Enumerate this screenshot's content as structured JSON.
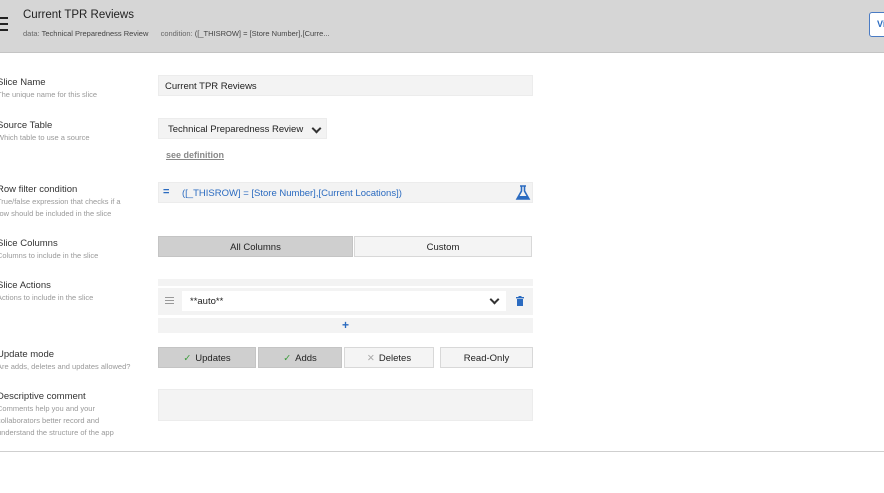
{
  "header": {
    "title": "Current TPR Reviews",
    "data_key": "data:",
    "data_value": "Technical Preparedness Review",
    "condition_key": "condition:",
    "condition_value": "([_THISROW] = [Store Number],[Curre...",
    "view_button": "Vi"
  },
  "form": {
    "slice_name": {
      "label": "Slice Name",
      "desc": "The unique name for this slice",
      "value": "Current TPR Reviews"
    },
    "source_table": {
      "label": "Source Table",
      "desc": "Which table to use a source",
      "value": "Technical Preparedness Review",
      "link": "see definition"
    },
    "row_filter": {
      "label": "Row filter condition",
      "desc_lines": [
        "True/false expression that checks if a",
        "row should be included in the slice"
      ],
      "expr_icon": "=",
      "value": "([_THISROW] = [Store Number],[Current Locations])"
    },
    "slice_columns": {
      "label": "Slice Columns",
      "desc": "Columns to include in the slice",
      "options": [
        "All Columns",
        "Custom"
      ],
      "selected": "All Columns"
    },
    "slice_actions": {
      "label": "Slice Actions",
      "desc": "Actions to include in the slice",
      "value": "**auto**",
      "add_label": "+"
    },
    "update_mode": {
      "label": "Update mode",
      "desc": "Are adds, deletes and updates allowed?",
      "options": [
        {
          "label": "Updates",
          "mark": "✓"
        },
        {
          "label": "Adds",
          "mark": "✓"
        },
        {
          "label": "Deletes",
          "mark": "✕"
        },
        {
          "label": "Read-Only",
          "mark": ""
        }
      ]
    },
    "comment": {
      "label": "Descriptive comment",
      "desc_lines": [
        "Comments help you and your",
        "collaborators better record and",
        "understand the structure of the app"
      ],
      "value": ""
    }
  },
  "colors": {
    "accent": "#2b6bc0",
    "header_bg": "#d6d6d6",
    "check": "#3a9c3a"
  },
  "icons": [
    "hamburger-menu-icon",
    "equals-icon",
    "flask-icon",
    "drag-handle-icon",
    "chevron-down-icon",
    "trash-icon",
    "check-icon",
    "x-icon",
    "resize-handle-icon"
  ]
}
